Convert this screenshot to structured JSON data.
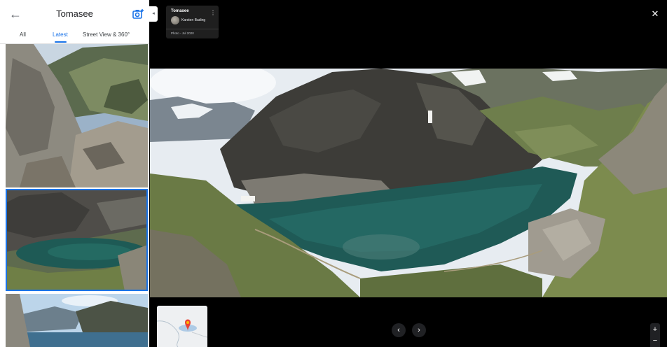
{
  "header": {
    "title": "Tomasee",
    "back_icon": "arrow-left-icon",
    "camera_icon": "add-photo-icon"
  },
  "tabs": [
    {
      "label": "All",
      "active": false
    },
    {
      "label": "Latest",
      "active": true
    },
    {
      "label": "Street View & 360°",
      "active": false
    }
  ],
  "photo_info": {
    "title": "Tomasee",
    "author": "Karsten Bading",
    "date": "Photo - Jul 2020"
  },
  "controls": {
    "prev": "‹",
    "next": "›",
    "zoom_in": "+",
    "zoom_out": "−",
    "close": "✕",
    "menu": "⋮",
    "collapse": "◂"
  },
  "colors": {
    "accent": "#1a73e8",
    "lake": "#1e5a55",
    "map_pin": "#ea4335"
  }
}
